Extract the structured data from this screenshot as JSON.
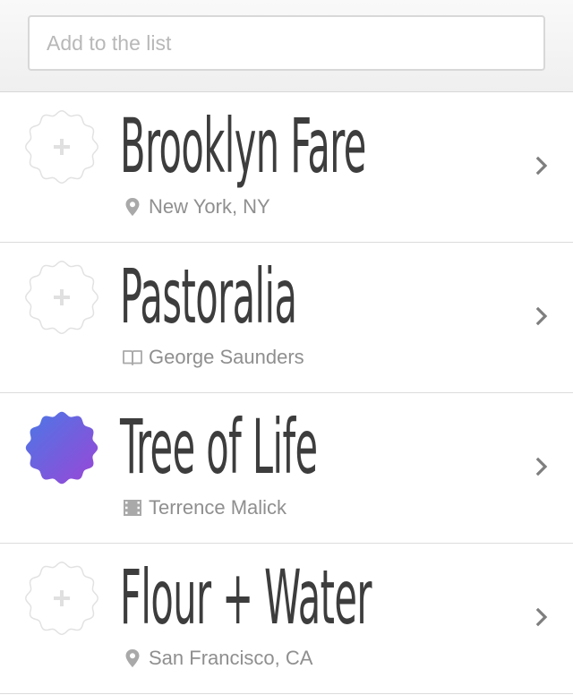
{
  "search": {
    "placeholder": "Add to the list"
  },
  "items": [
    {
      "title": "Brooklyn Fare",
      "subtitle": "New York, NY",
      "subtitle_icon": "location-pin-icon",
      "checked": false
    },
    {
      "title": "Pastoralia",
      "subtitle": "George Saunders",
      "subtitle_icon": "book-icon",
      "checked": false
    },
    {
      "title": "Tree of Life",
      "subtitle": "Terrence Malick",
      "subtitle_icon": "film-icon",
      "checked": true
    },
    {
      "title": "Flour + Water",
      "subtitle": "San Francisco, CA",
      "subtitle_icon": "location-pin-icon",
      "checked": false
    }
  ],
  "colors": {
    "title": "#3d3d3d",
    "subtitle": "#8f8f8f",
    "badge_outline": "#e3e3e3",
    "badge_checked_start": "#4a78e6",
    "badge_checked_end": "#9b46d6"
  }
}
